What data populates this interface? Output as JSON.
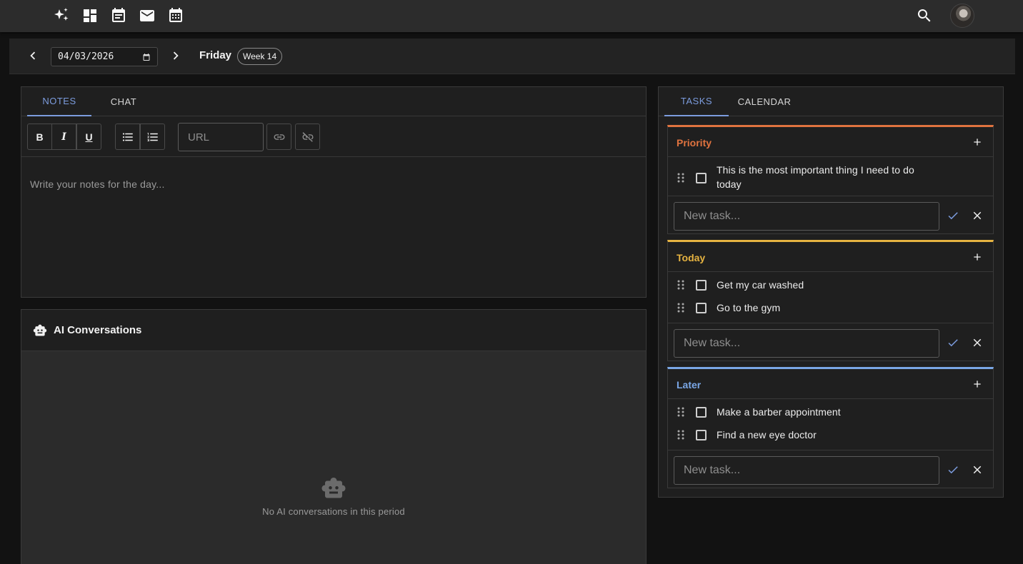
{
  "topbar": {
    "icons": [
      "sparkle-icon",
      "dashboard-icon",
      "event-note-icon",
      "mail-icon",
      "calendar-grid-icon"
    ],
    "search_icon": "search-icon",
    "avatar_icon": "avatar"
  },
  "datebar": {
    "date_value": "04/03/2026",
    "day_name": "Friday",
    "week_label": "Week 14"
  },
  "notes_panel": {
    "tabs": [
      {
        "label": "NOTES",
        "active": true
      },
      {
        "label": "CHAT",
        "active": false
      }
    ],
    "toolbar": {
      "bold_label": "B",
      "italic_label": "I",
      "underline_label": "U",
      "url_placeholder": "URL"
    },
    "placeholder": "Write your notes for the day..."
  },
  "ai_panel": {
    "title": "AI Conversations",
    "empty_text": "No AI conversations in this period"
  },
  "tasks_panel": {
    "tabs": [
      {
        "label": "TASKS",
        "active": true
      },
      {
        "label": "CALENDAR",
        "active": false
      }
    ],
    "new_task_placeholder": "New task...",
    "sections": [
      {
        "title": "Priority",
        "color": "#e0733f",
        "tasks": [
          {
            "text": "This is the most important thing I need to do today",
            "done": false
          }
        ]
      },
      {
        "title": "Today",
        "color": "#e6b341",
        "tasks": [
          {
            "text": "Get my car washed",
            "done": false
          },
          {
            "text": "Go to the gym",
            "done": false
          }
        ]
      },
      {
        "title": "Later",
        "color": "#7aa7e6",
        "tasks": [
          {
            "text": "Make a barber appointment",
            "done": false
          },
          {
            "text": "Find a new eye doctor",
            "done": false
          }
        ]
      }
    ]
  },
  "colors": {
    "accent": "#7c9cde",
    "background": "#121212",
    "surface": "#1f1f1f"
  }
}
